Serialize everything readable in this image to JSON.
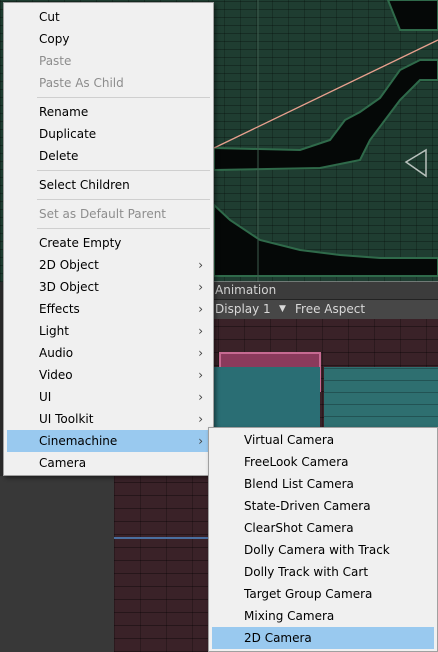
{
  "background": {
    "animation_tab": "Animation",
    "display_label": "Display 1",
    "aspect_label": "Free Aspect"
  },
  "main_menu": {
    "items": [
      {
        "label": "Cut",
        "enabled": true
      },
      {
        "label": "Copy",
        "enabled": true
      },
      {
        "label": "Paste",
        "enabled": false
      },
      {
        "label": "Paste As Child",
        "enabled": false
      },
      {
        "label": "Rename",
        "enabled": true
      },
      {
        "label": "Duplicate",
        "enabled": true
      },
      {
        "label": "Delete",
        "enabled": true
      },
      {
        "label": "Select Children",
        "enabled": true
      },
      {
        "label": "Set as Default Parent",
        "enabled": false
      },
      {
        "label": "Create Empty",
        "enabled": true
      },
      {
        "label": "2D Object",
        "enabled": true,
        "submenu": true
      },
      {
        "label": "3D Object",
        "enabled": true,
        "submenu": true
      },
      {
        "label": "Effects",
        "enabled": true,
        "submenu": true
      },
      {
        "label": "Light",
        "enabled": true,
        "submenu": true
      },
      {
        "label": "Audio",
        "enabled": true,
        "submenu": true
      },
      {
        "label": "Video",
        "enabled": true,
        "submenu": true
      },
      {
        "label": "UI",
        "enabled": true,
        "submenu": true
      },
      {
        "label": "UI Toolkit",
        "enabled": true,
        "submenu": true
      },
      {
        "label": "Cinemachine",
        "enabled": true,
        "submenu": true,
        "highlighted": true
      },
      {
        "label": "Camera",
        "enabled": true
      }
    ]
  },
  "cinemachine_submenu": {
    "items": [
      {
        "label": "Virtual Camera"
      },
      {
        "label": "FreeLook Camera"
      },
      {
        "label": "Blend List Camera"
      },
      {
        "label": "State-Driven Camera"
      },
      {
        "label": "ClearShot Camera"
      },
      {
        "label": "Dolly Camera with Track"
      },
      {
        "label": "Dolly Track with Cart"
      },
      {
        "label": "Target Group Camera"
      },
      {
        "label": "Mixing Camera"
      },
      {
        "label": "2D Camera",
        "highlighted": true
      }
    ]
  },
  "colors": {
    "menu_bg": "#f0f0f0",
    "highlight": "#99c9ef",
    "disabled_text": "#8d8d8d",
    "scene_bg": "#1f3d31",
    "game_bg": "#3a2228"
  },
  "icons": {
    "submenu_arrow": "chevron-right-icon",
    "dropdown_arrow": "triangle-down-icon"
  }
}
